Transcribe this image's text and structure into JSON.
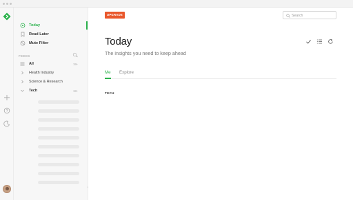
{
  "sidebar": {
    "nav": [
      {
        "label": "Today",
        "icon": "today-icon",
        "active": true
      },
      {
        "label": "Read Later",
        "icon": "bookmark-icon",
        "active": false
      },
      {
        "label": "Mute Filter",
        "icon": "mute-icon",
        "active": false
      }
    ],
    "feeds_label": "FEEDS",
    "feeds": [
      {
        "label": "All",
        "icon": "all-feeds-icon",
        "count": "19+",
        "bold": true
      },
      {
        "label": "Health Industry",
        "icon": "chevron-right-icon",
        "count": "",
        "bold": false
      },
      {
        "label": "Science & Research",
        "icon": "chevron-right-icon",
        "count": "",
        "bold": false
      },
      {
        "label": "Tech",
        "icon": "chevron-down-icon",
        "count": "19+",
        "bold": true
      }
    ]
  },
  "header": {
    "upgrade_label": "UPGRADE",
    "search_placeholder": "Search"
  },
  "main": {
    "title": "Today",
    "subtitle": "The insights you need to keep ahead",
    "tabs": [
      {
        "label": "Me",
        "active": true
      },
      {
        "label": "Explore",
        "active": false
      }
    ],
    "section_label": "TECH"
  },
  "colors": {
    "accent": "#2bb24c",
    "upgrade": "#e9572b"
  }
}
